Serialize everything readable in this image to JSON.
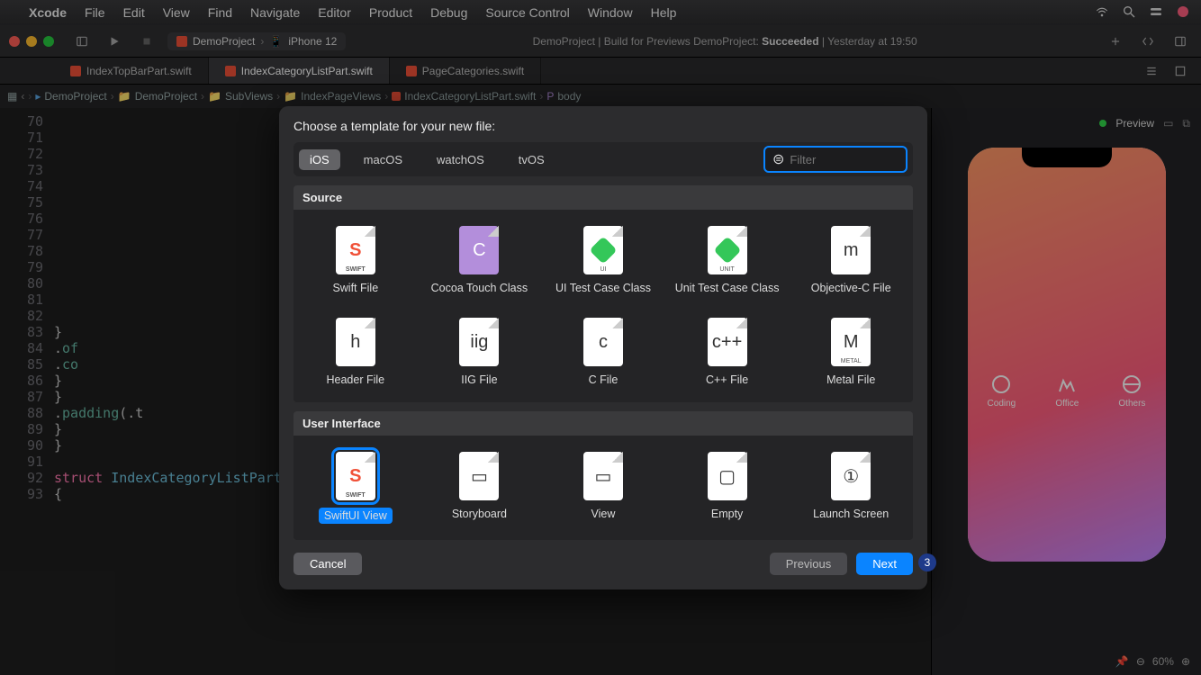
{
  "menubar": {
    "app": "Xcode",
    "items": [
      "File",
      "Edit",
      "View",
      "Find",
      "Navigate",
      "Editor",
      "Product",
      "Debug",
      "Source Control",
      "Window",
      "Help"
    ]
  },
  "toolbar": {
    "scheme": "DemoProject",
    "device": "iPhone 12",
    "status_prefix": "DemoProject | Build for Previews DemoProject: ",
    "status_result": "Succeeded",
    "status_time": " | Yesterday at 19:50"
  },
  "tabs": [
    {
      "label": "IndexTopBarPart.swift",
      "active": false
    },
    {
      "label": "IndexCategoryListPart.swift",
      "active": true
    },
    {
      "label": "PageCategories.swift",
      "active": false
    }
  ],
  "breadcrumbs": [
    "DemoProject",
    "DemoProject",
    "SubViews",
    "IndexPageViews",
    "IndexCategoryListPart.swift",
    "body"
  ],
  "code_lines": [
    {
      "n": 70,
      "t": ""
    },
    {
      "n": 71,
      "t": ""
    },
    {
      "n": 72,
      "t": ""
    },
    {
      "n": 73,
      "t": ""
    },
    {
      "n": 74,
      "t": ""
    },
    {
      "n": 75,
      "t": ""
    },
    {
      "n": 76,
      "t": ""
    },
    {
      "n": 77,
      "t": ""
    },
    {
      "n": 78,
      "t": ""
    },
    {
      "n": 79,
      "t": ""
    },
    {
      "n": 80,
      "t": ""
    },
    {
      "n": 81,
      "t": ""
    },
    {
      "n": 82,
      "t": ""
    },
    {
      "n": 83,
      "t": "                }"
    },
    {
      "n": 84,
      "t": "                .of"
    },
    {
      "n": 85,
      "t": "                .co"
    },
    {
      "n": 86,
      "t": "            }"
    },
    {
      "n": 87,
      "t": "        }"
    },
    {
      "n": 88,
      "t": "        .padding(.t"
    },
    {
      "n": 89,
      "t": "    }"
    },
    {
      "n": 90,
      "t": "}"
    },
    {
      "n": 91,
      "t": ""
    },
    {
      "n": 92,
      "t": "struct IndexCategoryListPart_Previews: PreviewProvider"
    },
    {
      "n": 93,
      "t": "{"
    }
  ],
  "dialog": {
    "title": "Choose a template for your new file:",
    "platforms": [
      "iOS",
      "macOS",
      "watchOS",
      "tvOS"
    ],
    "platform_selected": "iOS",
    "filter_placeholder": "Filter",
    "sections": [
      {
        "name": "Source",
        "items": [
          {
            "label": "Swift File",
            "glyph": "S",
            "cls": "swift",
            "tag": "SWIFT"
          },
          {
            "label": "Cocoa Touch Class",
            "glyph": "C",
            "cls": "cc"
          },
          {
            "label": "UI Test Case Class",
            "glyph": "",
            "cls": "green",
            "tag": "UI"
          },
          {
            "label": "Unit Test Case Class",
            "glyph": "",
            "cls": "green",
            "tag": "UNIT"
          },
          {
            "label": "Objective-C File",
            "glyph": "m",
            "cls": ""
          },
          {
            "label": "Header File",
            "glyph": "h",
            "cls": ""
          },
          {
            "label": "IIG File",
            "glyph": "iig",
            "cls": ""
          },
          {
            "label": "C File",
            "glyph": "c",
            "cls": ""
          },
          {
            "label": "C++ File",
            "glyph": "c++",
            "cls": ""
          },
          {
            "label": "Metal File",
            "glyph": "M",
            "cls": "",
            "tag": "METAL"
          }
        ]
      },
      {
        "name": "User Interface",
        "items": [
          {
            "label": "SwiftUI View",
            "glyph": "S",
            "cls": "swift",
            "tag": "SWIFT",
            "selected": true
          },
          {
            "label": "Storyboard",
            "glyph": "▭",
            "cls": ""
          },
          {
            "label": "View",
            "glyph": "▭",
            "cls": ""
          },
          {
            "label": "Empty",
            "glyph": "▢",
            "cls": ""
          },
          {
            "label": "Launch Screen",
            "glyph": "①",
            "cls": ""
          }
        ]
      }
    ],
    "buttons": {
      "cancel": "Cancel",
      "previous": "Previous",
      "next": "Next"
    }
  },
  "preview": {
    "label": "Preview",
    "categories": [
      "Coding",
      "Office",
      "Others"
    ],
    "zoom": "60%"
  },
  "annotation": {
    "step": "3"
  }
}
